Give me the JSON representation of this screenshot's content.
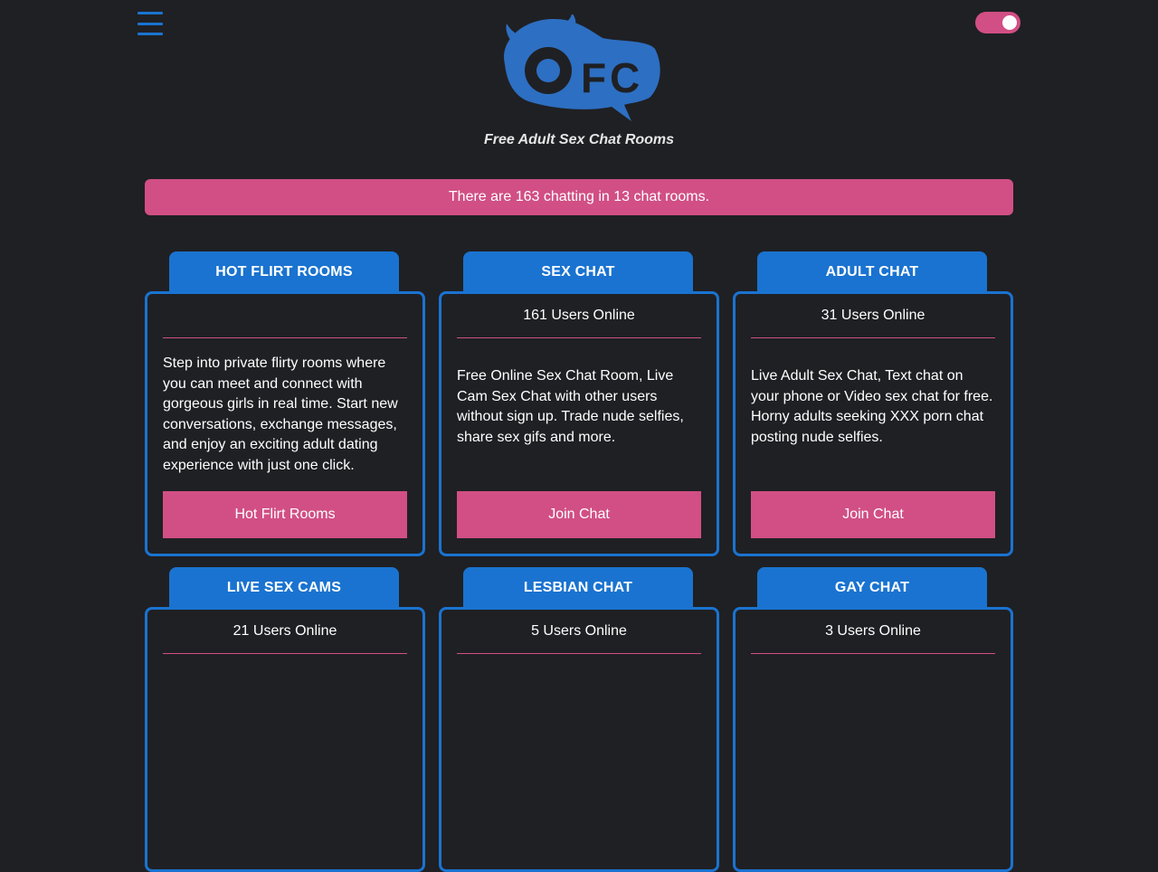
{
  "brand": {
    "logo_text": "OFC",
    "tagline": "Free Adult Sex Chat Rooms",
    "accent": "#1a73d0",
    "pink": "#d14f85",
    "background": "#1f2024"
  },
  "icons": {
    "menu": "hamburger-icon",
    "theme": "toggle-switch"
  },
  "banner": {
    "text": "There are 163 chatting in 13 chat rooms."
  },
  "rooms": [
    {
      "title": "HOT FLIRT ROOMS",
      "users": "",
      "description": "Step into private flirty rooms where you can meet and connect with gorgeous girls in real time. Start new conversations, exchange messages, and enjoy an exciting adult dating experience with just one click.",
      "button": "Hot Flirt Rooms"
    },
    {
      "title": "SEX CHAT",
      "users": "161 Users Online",
      "description": "Free Online Sex Chat Room, Live Cam Sex Chat with other users without sign up. Trade nude selfies, share sex gifs and more.",
      "button": "Join Chat"
    },
    {
      "title": "ADULT CHAT",
      "users": "31 Users Online",
      "description": "Live Adult Sex Chat, Text chat on your phone or Video sex chat for free. Horny adults seeking XXX porn chat posting nude selfies.",
      "button": "Join Chat"
    },
    {
      "title": "LIVE SEX CAMS",
      "users": "21 Users Online",
      "description": "",
      "button": ""
    },
    {
      "title": "LESBIAN CHAT",
      "users": "5 Users Online",
      "description": "",
      "button": ""
    },
    {
      "title": "GAY CHAT",
      "users": "3 Users Online",
      "description": "",
      "button": ""
    }
  ]
}
